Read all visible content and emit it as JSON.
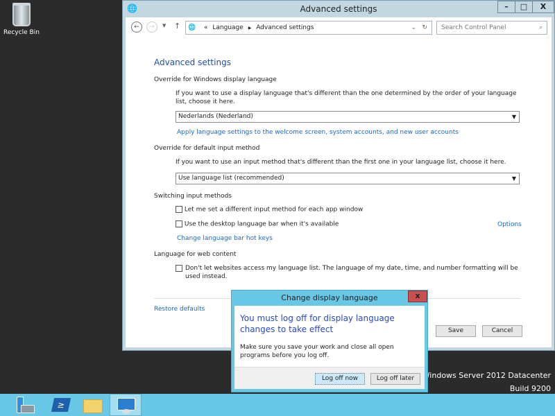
{
  "desktop": {
    "recycle_bin": "Recycle Bin",
    "watermark_line1": "Windows Server 2012 Datacenter",
    "watermark_line2": "Build 9200"
  },
  "window": {
    "title": "Advanced settings",
    "minimize": "–",
    "maximize": "□",
    "close": "X",
    "breadcrumb": {
      "overflow": "«",
      "items": [
        "Language",
        "Advanced settings"
      ]
    },
    "search_placeholder": "Search Control Panel"
  },
  "page": {
    "heading": "Advanced settings",
    "display_language": {
      "title": "Override for Windows display language",
      "desc": "If you want to use a display language that's different than the one determined by the order of your language list, choose it here.",
      "selected": "Nederlands (Nederland)",
      "link": "Apply language settings to the welcome screen, system accounts, and new user accounts"
    },
    "input_method": {
      "title": "Override for default input method",
      "desc": "If you want to use an input method that's different than the first one in your language list, choose it here.",
      "selected": "Use language list (recommended)"
    },
    "switching": {
      "title": "Switching input methods",
      "opt1": "Let me set a different input method for each app window",
      "opt1_checked": false,
      "opt2": "Use the desktop language bar when it's available",
      "opt2_checked": false,
      "options_link": "Options",
      "hotkeys_link": "Change language bar hot keys"
    },
    "web": {
      "title": "Language for web content",
      "opt": "Don't let websites access my language list. The language of my date, time, and number formatting will be used instead.",
      "opt_checked": false
    },
    "restore": "Restore defaults",
    "save": "Save",
    "cancel": "Cancel"
  },
  "dialog": {
    "title": "Change display language",
    "close": "x",
    "heading": "You must log off for display language changes to take effect",
    "message": "Make sure you save your work and close all open programs before you log off.",
    "primary": "Log off now",
    "secondary": "Log off later"
  },
  "taskbar": {
    "items": [
      "server-manager-icon",
      "powershell-icon",
      "file-explorer-icon",
      "control-panel-icon"
    ],
    "active": 3,
    "color": "#68c7e5"
  }
}
